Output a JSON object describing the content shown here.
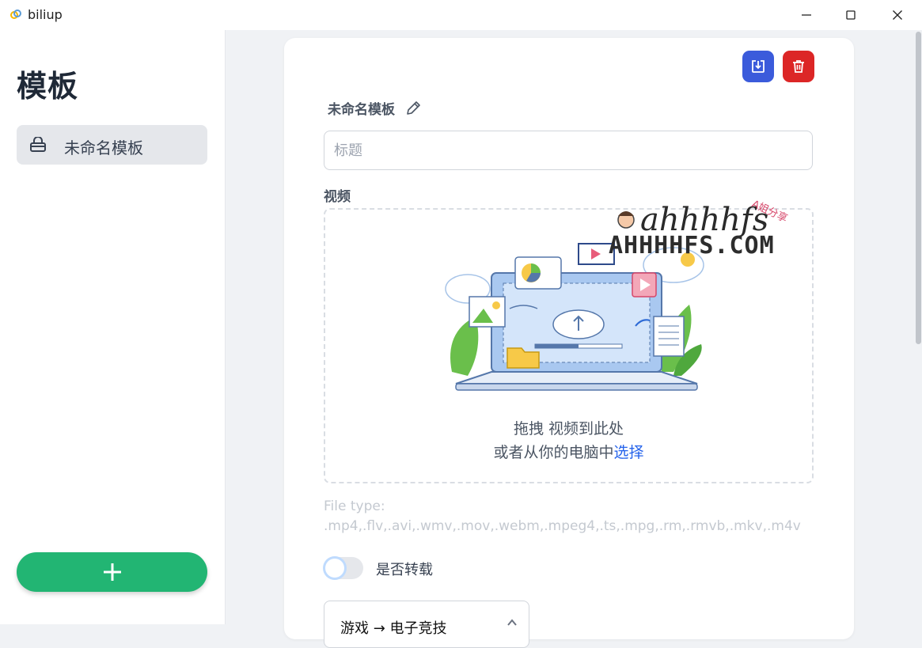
{
  "window": {
    "title": "biliup",
    "controls": [
      "minimize-icon",
      "maximize-icon",
      "close-icon"
    ]
  },
  "sidebar": {
    "title": "模板",
    "items": [
      {
        "label": "未命名模板",
        "icon": "template-icon",
        "selected": true
      }
    ],
    "add_button_icon": "plus-icon"
  },
  "main": {
    "actions": {
      "save_icon": "save-download-icon",
      "delete_icon": "trash-icon"
    },
    "template_name": "未命名模板",
    "title_input": {
      "placeholder": "标题",
      "value": ""
    },
    "video_section_label": "视频",
    "dropzone": {
      "line1": "拖拽 视频到此处",
      "line2_prefix": "或者从你的电脑中",
      "line2_link": "选择"
    },
    "file_type_label": "File type:",
    "file_types": ".mp4,.flv,.avi,.wmv,.mov,.webm,.mpeg4,.ts,.mpg,.rm,.rmvb,.mkv,.m4v",
    "repost_toggle": {
      "label": "是否转载",
      "on": false
    },
    "category_select": {
      "value": "游戏 → 电子竞技"
    }
  },
  "watermark": {
    "logo_text": "ahhhhfs",
    "badge": "A姐分享",
    "domain": "AHHHHFS.COM"
  },
  "colors": {
    "accent_green": "#22b573",
    "save_blue": "#3b5bdb",
    "delete_red": "#dc2626",
    "link_blue": "#2563eb"
  }
}
